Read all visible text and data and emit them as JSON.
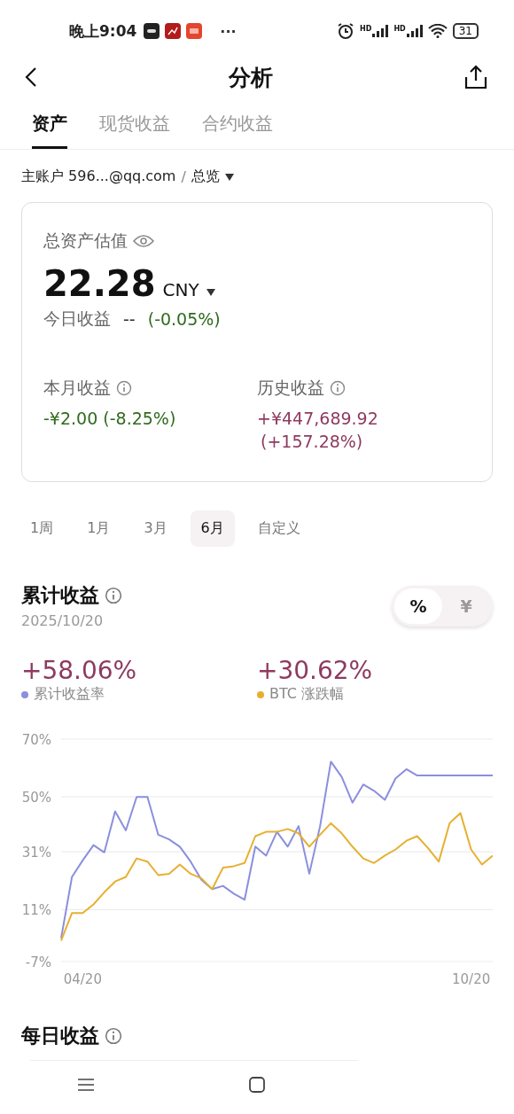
{
  "status_bar": {
    "time": "晚上9:04",
    "more": "···",
    "signal_labels": [
      "HD",
      "HD"
    ],
    "battery": "31"
  },
  "header": {
    "title": "分析"
  },
  "tabs": [
    {
      "label": "资产",
      "selected": true
    },
    {
      "label": "现货收益",
      "selected": false
    },
    {
      "label": "合约收益",
      "selected": false
    }
  ],
  "account": {
    "label": "主账户 596...@qq.com",
    "separator": "/",
    "view": "总览"
  },
  "card": {
    "title": "总资产估值",
    "value": "22.28",
    "currency": "CNY",
    "today_label": "今日收益",
    "today_value": "--",
    "today_pct": "(-0.05%)",
    "month_label": "本月收益",
    "month_value": "-¥2.00 (-8.25%)",
    "history_label": "历史收益",
    "history_value": "+¥447,689.92",
    "history_pct": "(+157.28%)"
  },
  "periods": [
    {
      "label": "1周",
      "selected": false
    },
    {
      "label": "1月",
      "selected": false
    },
    {
      "label": "3月",
      "selected": false
    },
    {
      "label": "6月",
      "selected": true
    },
    {
      "label": "自定义",
      "selected": false
    }
  ],
  "cumulative": {
    "title": "累计收益",
    "date": "2025/10/20",
    "unit_toggle": [
      {
        "label": "%",
        "selected": true
      },
      {
        "label": "¥",
        "selected": false
      }
    ],
    "stats": [
      {
        "value": "+58.06%"
      },
      {
        "value": "+30.62%"
      }
    ],
    "chart_data": {
      "type": "line",
      "categories": [
        null,
        null,
        "04/20",
        null,
        null,
        null,
        null,
        null,
        null,
        null,
        null,
        null,
        null,
        null,
        null,
        null,
        null,
        null,
        null,
        null,
        null,
        null,
        null,
        null,
        null,
        null,
        null,
        null,
        null,
        null,
        null,
        null,
        null,
        null,
        null,
        null,
        null,
        null,
        "10/20",
        null,
        null
      ],
      "yticks": [
        {
          "value": -7,
          "label": "-7%"
        },
        {
          "value": 11,
          "label": "11%"
        },
        {
          "value": 31,
          "label": "31%"
        },
        {
          "value": 50,
          "label": "50%"
        },
        {
          "value": 70,
          "label": "70%"
        }
      ],
      "ylim": [
        -7,
        70
      ],
      "grid": true,
      "series": [
        {
          "name": "累计收益率",
          "color": "#8b8fdc",
          "values": [
            1.1,
            22.3,
            28,
            33.3,
            30.8,
            45,
            38.4,
            50,
            50,
            36.9,
            35.3,
            32.8,
            27.6,
            21.3,
            18.1,
            19.2,
            16.5,
            14.4,
            32.8,
            29.7,
            37.9,
            32.8,
            39.9,
            23.4,
            39.9,
            62.2,
            56.9,
            48,
            54.3,
            52.1,
            49,
            56.4,
            59.6,
            57.4,
            57.4,
            57.4,
            57.4,
            57.4,
            57.4,
            57.4,
            57.4
          ]
        },
        {
          "name": "BTC 涨跌幅",
          "color": "#e6b030",
          "values": [
            0.2,
            9.8,
            9.8,
            12.8,
            17,
            20.7,
            22.3,
            28.7,
            27.6,
            22.9,
            23.4,
            26.6,
            23.4,
            21.8,
            18.1,
            25.5,
            26,
            27.1,
            36.4,
            37.9,
            37.9,
            38.9,
            37.4,
            32.8,
            36.9,
            40.9,
            37.4,
            32.8,
            28.7,
            27.1,
            29.7,
            31.8,
            34.8,
            36.4,
            32.3,
            27.6,
            40.9,
            44.4,
            31.8,
            26.6,
            29.7
          ]
        }
      ]
    }
  },
  "daily": {
    "title": "每日收益"
  }
}
